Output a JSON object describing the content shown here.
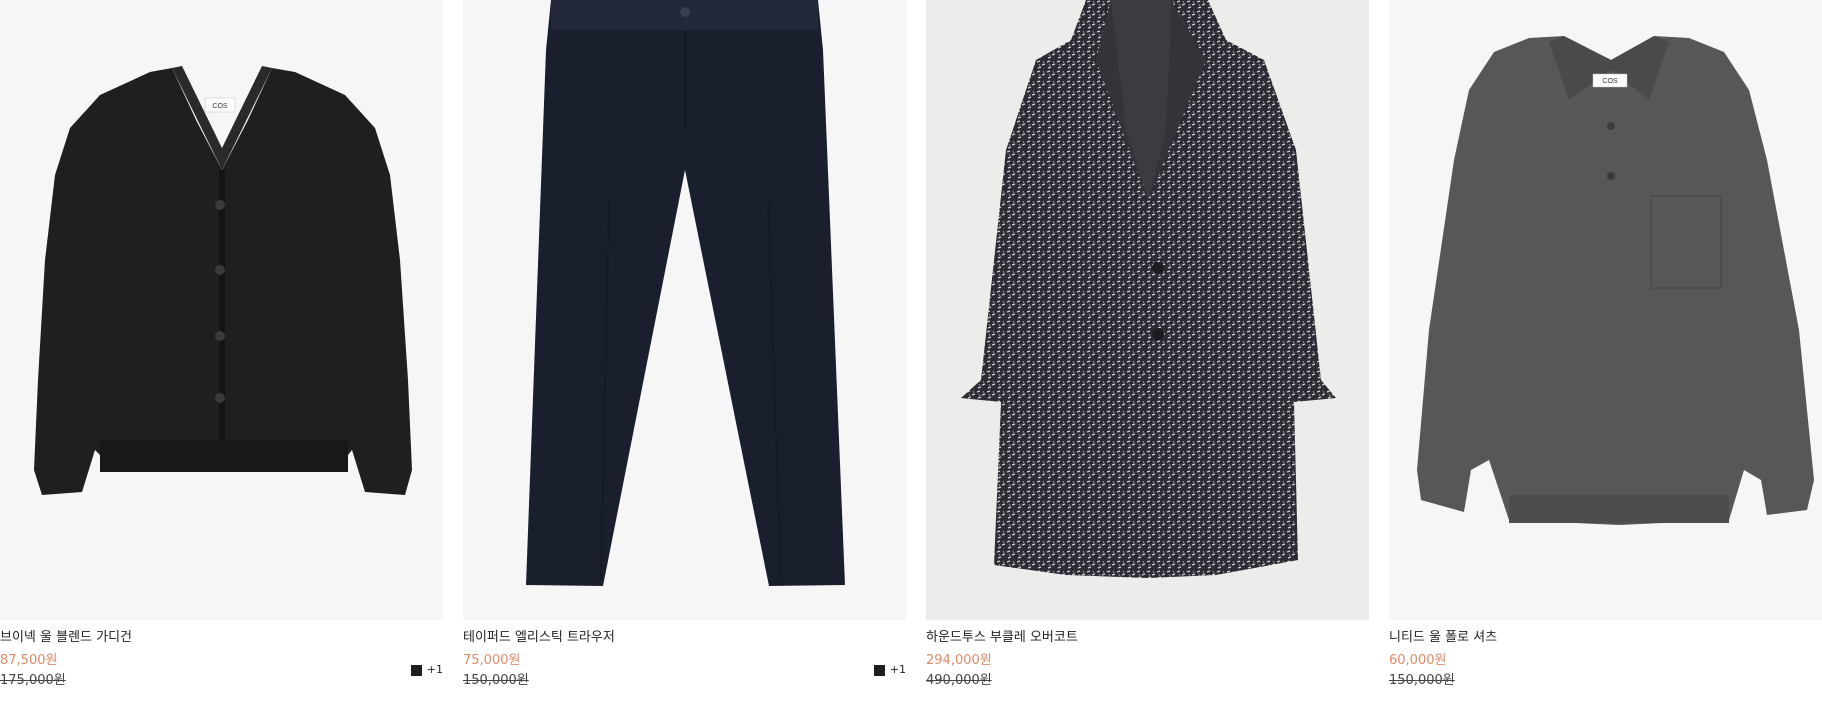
{
  "products": [
    {
      "name": "브이넥 울 블렌드 가디건",
      "sale_price": "87,500원",
      "original_price": "175,000원",
      "swatch_color": "#1e1e1e",
      "more_colors": "+1",
      "image_icon": "cardigan-image"
    },
    {
      "name": "테이퍼드 엘리스틱 트라우저",
      "sale_price": "75,000원",
      "original_price": "150,000원",
      "swatch_color": "#1e1e1e",
      "more_colors": "+1",
      "image_icon": "trousers-image"
    },
    {
      "name": "하운드투스 부클레 오버코트",
      "sale_price": "294,000원",
      "original_price": "490,000원",
      "swatch_color": "",
      "more_colors": "",
      "image_icon": "overcoat-image"
    },
    {
      "name": "니티드 울 폴로 셔츠",
      "sale_price": "60,000원",
      "original_price": "150,000원",
      "swatch_color": "#555555",
      "more_colors": "+",
      "image_icon": "polo-shirt-image"
    }
  ],
  "colors": {
    "sale": "#e08a6a",
    "image_bg": "#f6f6f6",
    "coat_bg": "#ececea"
  },
  "brand_label": "COS"
}
